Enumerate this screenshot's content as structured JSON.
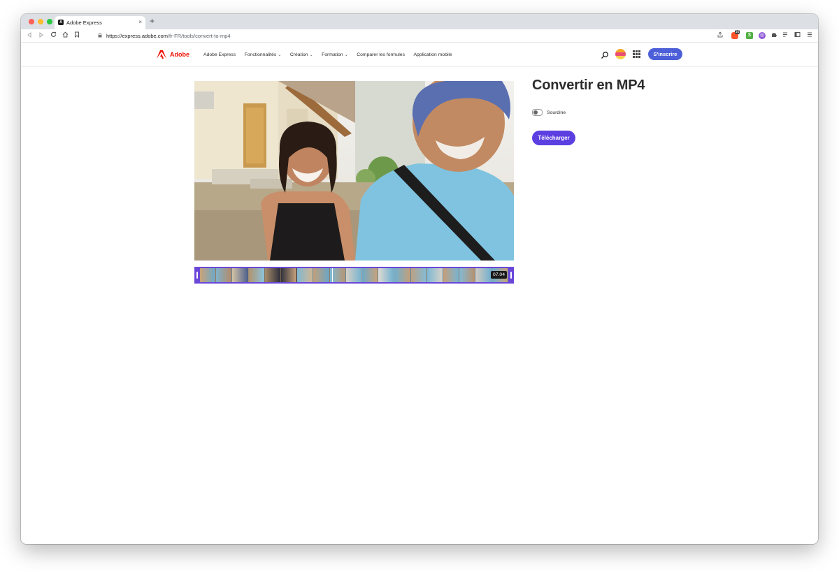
{
  "browser": {
    "tab_title": "Adobe Express",
    "tab_close": "×",
    "new_tab": "+",
    "url_host": "https://express.adobe.com",
    "url_path": "/fr-FR/tools/convert-to-mp4",
    "extension_badge": "16"
  },
  "header": {
    "logo_text": "Adobe",
    "nav": [
      {
        "label": "Adobe Express",
        "dropdown": false
      },
      {
        "label": "Fonctionnalités",
        "dropdown": true
      },
      {
        "label": "Création",
        "dropdown": true
      },
      {
        "label": "Formation",
        "dropdown": true
      },
      {
        "label": "Comparer les formules",
        "dropdown": false
      },
      {
        "label": "Application mobile",
        "dropdown": false
      }
    ],
    "chevron": "⌄",
    "signup_label": "S'inscrire"
  },
  "main": {
    "title": "Convertir en MP4",
    "mute_label": "Sourdine",
    "mute_on": false,
    "download_label": "Télécharger",
    "video_duration": "07.04"
  },
  "colors": {
    "accent": "#5c3fe0",
    "signup": "#4d5fd8",
    "adobe_red": "#eb1000"
  }
}
